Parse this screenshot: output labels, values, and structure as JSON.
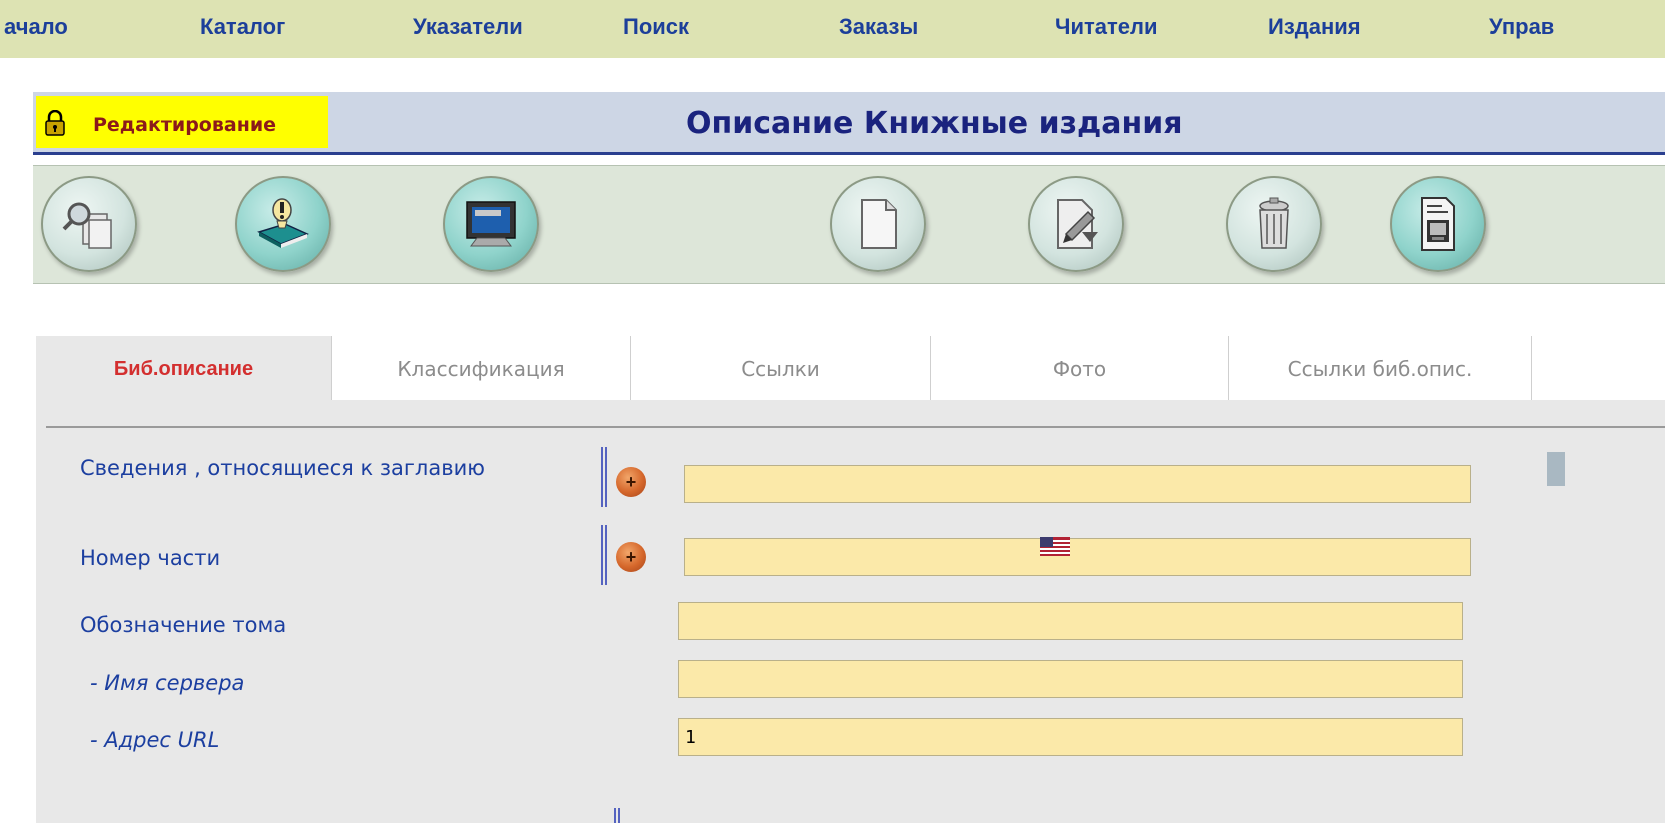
{
  "nav": {
    "items": [
      "ачало",
      "Каталог",
      "Указатели",
      "Поиск",
      "Заказы",
      "Читатели",
      "Издания",
      "Управ"
    ]
  },
  "header": {
    "edit_label": "Редактирование",
    "title": "Описание Книжные издания"
  },
  "toolbar": {
    "buttons": [
      "search-docs-icon",
      "book-info-icon",
      "monitor-icon",
      "new-document-icon",
      "edit-document-icon",
      "trash-icon",
      "print-document-icon"
    ]
  },
  "tabs": [
    {
      "label": "Биб.описание",
      "active": true
    },
    {
      "label": "Классификация",
      "active": false
    },
    {
      "label": "Ссылки",
      "active": false
    },
    {
      "label": "Фото",
      "active": false
    },
    {
      "label": "Ссылки биб.опис.",
      "active": false
    }
  ],
  "form": {
    "fields": [
      {
        "label": "Сведения , относящиеся к заглавию",
        "value": ""
      },
      {
        "label": "Номер части",
        "value": ""
      },
      {
        "label": "Обозначение тома",
        "value": ""
      },
      {
        "label": "- Имя сервера",
        "value": ""
      },
      {
        "label": "- Адрес URL",
        "value": "1"
      }
    ],
    "add_button": "+"
  },
  "colors": {
    "nav_bg": "#dde3b3",
    "nav_text": "#1c3f9a",
    "edit_highlight": "#ffff00",
    "input_bg": "#fbe9a9",
    "active_tab_text": "#d32f2f"
  }
}
